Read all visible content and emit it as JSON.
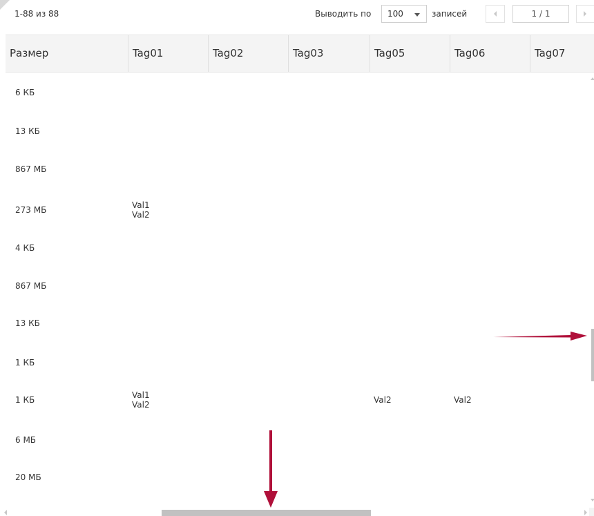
{
  "toolbar": {
    "record_count": "1-88 из 88",
    "per_page_label": "Выводить по",
    "per_page_value": "100",
    "records_label": "записей",
    "page_indicator": "1 / 1"
  },
  "table": {
    "columns": [
      "Размер",
      "Tag01",
      "Tag02",
      "Tag03",
      "Tag05",
      "Tag06",
      "Tag07"
    ],
    "rows": [
      [
        "6 КБ",
        "",
        "",
        "",
        "",
        "",
        ""
      ],
      [
        "13 КБ",
        "",
        "",
        "",
        "",
        "",
        ""
      ],
      [
        "867 МБ",
        "",
        "",
        "",
        "",
        "",
        ""
      ],
      [
        "273 МБ",
        "Val1\nVal2",
        "",
        "",
        "",
        "",
        ""
      ],
      [
        "4 КБ",
        "",
        "",
        "",
        "",
        "",
        ""
      ],
      [
        "867 МБ",
        "",
        "",
        "",
        "",
        "",
        ""
      ],
      [
        "13 КБ",
        "",
        "",
        "",
        "",
        "",
        ""
      ],
      [
        "1 КБ",
        "",
        "",
        "",
        "",
        "",
        ""
      ],
      [
        "1 КБ",
        "Val1\nVal2",
        "",
        "",
        "Val2",
        "Val2",
        ""
      ],
      [
        "6 МБ",
        "",
        "",
        "",
        "",
        "",
        ""
      ],
      [
        "20 МБ",
        "",
        "",
        "",
        "",
        "",
        ""
      ]
    ]
  },
  "colors": {
    "annotation_arrow": "#b0103a",
    "header_background": "#f4f4f4",
    "scrollbar_thumb": "#c1c1c1"
  },
  "icons": {
    "page_select_caret": "chevron-down-icon",
    "pager_prev": "chevron-left-icon",
    "pager_next": "chevron-right-icon",
    "annotation_right": "arrow-right-icon",
    "annotation_down": "arrow-down-icon"
  }
}
